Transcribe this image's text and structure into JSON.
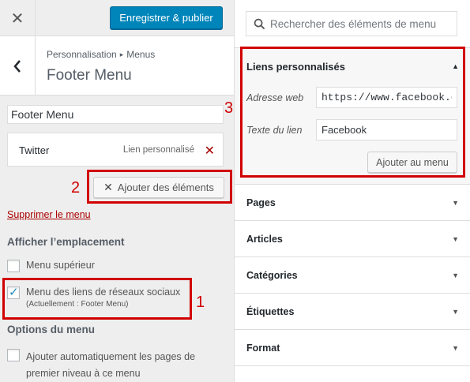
{
  "topbar": {
    "close_icon": "close-icon",
    "publish_label": "Enregistrer & publier"
  },
  "header": {
    "breadcrumb_root": "Personnalisation",
    "breadcrumb_separator": "▸",
    "breadcrumb_current": "Menus",
    "title": "Footer Menu"
  },
  "menu": {
    "name_value": "Footer Menu",
    "items": [
      {
        "title": "Twitter",
        "type": "Lien personnalisé"
      }
    ],
    "add_items_label": "Ajouter des éléments",
    "delete_label": "Supprimer le menu"
  },
  "locations": {
    "heading": "Afficher l’emplacement",
    "top_menu_label": "Menu supérieur",
    "top_menu_checked": false,
    "social_label": "Menu des liens de réseaux sociaux",
    "social_note": "(Actuellement : Footer Menu)",
    "social_checked": true
  },
  "options": {
    "heading": "Options du menu",
    "auto_add_label": "Ajouter automatiquement les pages de premier niveau à ce menu",
    "auto_add_checked": false
  },
  "search": {
    "placeholder": "Rechercher des éléments de menu"
  },
  "custom_links": {
    "title": "Liens personnalisés",
    "url_label": "Adresse web",
    "url_value": "https://www.facebook.com",
    "text_label": "Texte du lien",
    "text_value": "Facebook",
    "add_button": "Ajouter au menu"
  },
  "sections": [
    {
      "label": "Pages"
    },
    {
      "label": "Articles"
    },
    {
      "label": "Catégories"
    },
    {
      "label": "Étiquettes"
    },
    {
      "label": "Format"
    }
  ],
  "annotations": {
    "n1": "1",
    "n2": "2",
    "n3": "3"
  },
  "colors": {
    "publish_blue": "#0085ba",
    "annotation_red": "#d10000",
    "checkbox_blue": "#1e8cbe",
    "delete_red": "#a00"
  }
}
